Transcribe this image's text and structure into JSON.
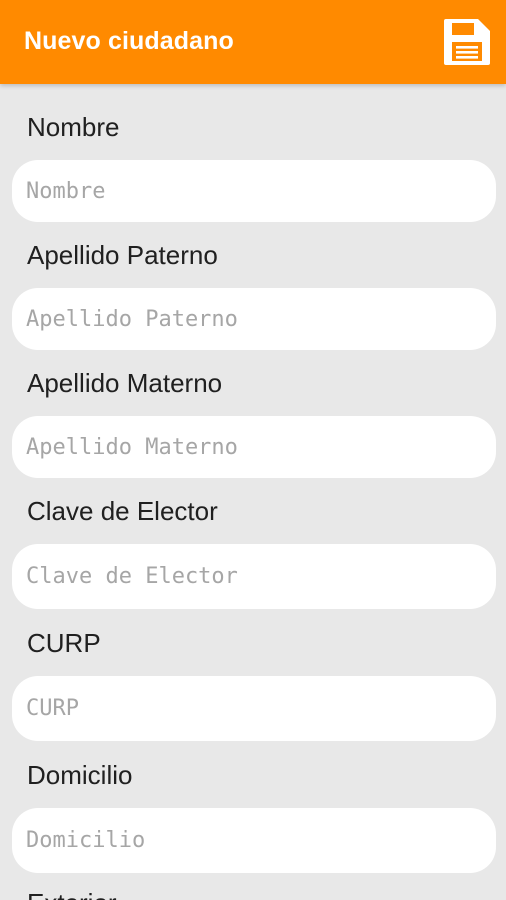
{
  "appbar": {
    "title": "Nuevo ciudadano",
    "background": "#ff8a00",
    "save_icon": "save-floppy-icon"
  },
  "form": {
    "fields": [
      {
        "label": "Nombre",
        "placeholder": "Nombre",
        "value": ""
      },
      {
        "label": "Apellido Paterno",
        "placeholder": "Apellido Paterno",
        "value": ""
      },
      {
        "label": "Apellido Materno",
        "placeholder": "Apellido Materno",
        "value": ""
      },
      {
        "label": "Clave de Elector",
        "placeholder": "Clave de Elector",
        "value": ""
      },
      {
        "label": "CURP",
        "placeholder": "CURP",
        "value": ""
      },
      {
        "label": "Domicilio",
        "placeholder": "Domicilio",
        "value": ""
      },
      {
        "label": "Exterior"
      }
    ]
  }
}
